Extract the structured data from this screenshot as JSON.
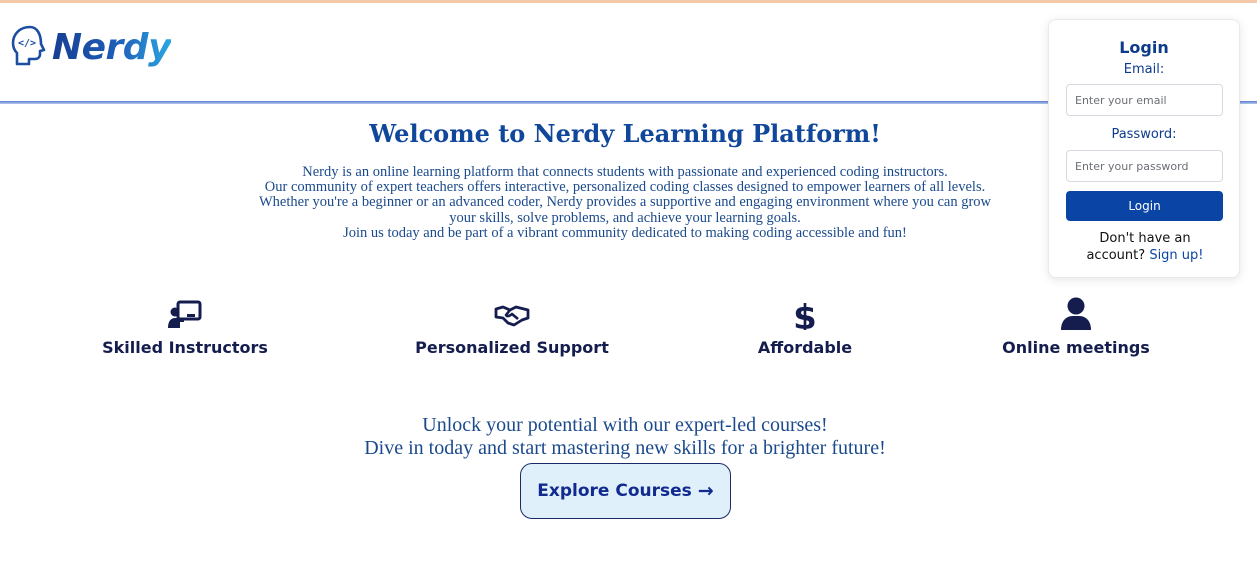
{
  "brand": {
    "name": "Nerdy",
    "icon": "coding-head-icon"
  },
  "login": {
    "title": "Login",
    "email_label": "Email:",
    "email_placeholder": "Enter your email",
    "password_label": "Password:",
    "password_placeholder": "Enter your password",
    "button_label": "Login",
    "signup_prompt": "Don't have an account?",
    "signup_link": "Sign up!"
  },
  "main": {
    "title": "Welcome to Nerdy Learning Platform!",
    "intro_lines": [
      "Nerdy is an online learning platform that connects students with passionate and experienced coding instructors.",
      "Our community of expert teachers offers interactive, personalized coding classes designed to empower learners of all levels. Whether you're a beginner or an advanced coder, Nerdy provides a supportive and engaging environment where you can grow your skills, solve problems, and achieve your learning goals.",
      "Join us today and be part of a vibrant community dedicated to making coding accessible and fun!"
    ]
  },
  "features": [
    {
      "label": "Skilled Instructors",
      "icon": "teacher-board-icon"
    },
    {
      "label": "Personalized Support",
      "icon": "handshake-icon"
    },
    {
      "label": "Affordable",
      "icon": "dollar-icon"
    },
    {
      "label": "Online meetings",
      "icon": "user-icon"
    }
  ],
  "cta": {
    "line1": "Unlock your potential with our expert-led courses!",
    "line2": "Dive in today and start mastering new skills for a brighter future!",
    "button_label": "Explore Courses",
    "button_arrow": "→"
  },
  "colors": {
    "brand_dark": "#0d3b8c",
    "primary_button": "#0a45a6",
    "feature_text": "#141d4d",
    "cta_bg": "#dff0fb"
  }
}
